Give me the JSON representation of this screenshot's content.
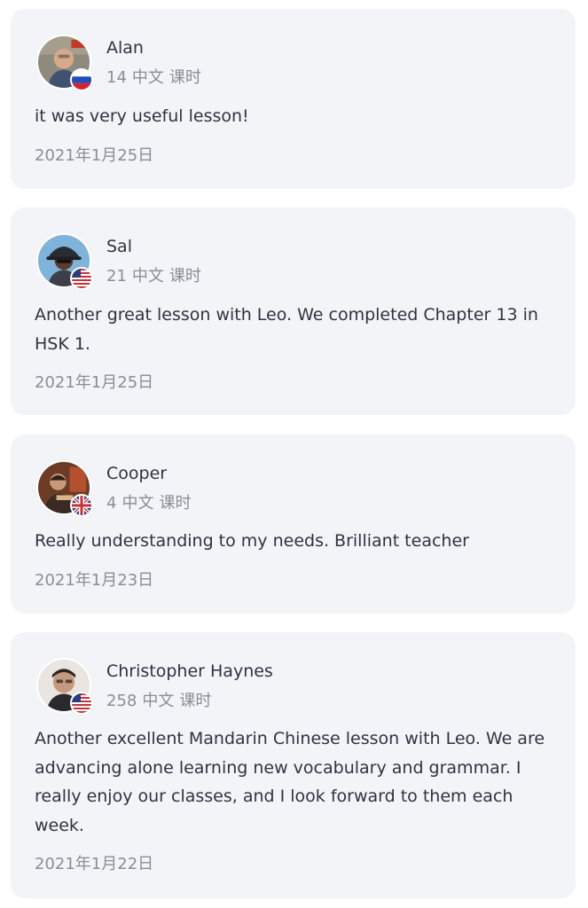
{
  "reviews": [
    {
      "name": "Alan",
      "lesson_count": "14",
      "language": "中文",
      "lessons_unit": "课时",
      "comment": "it was very useful lesson!",
      "date": "2021年1月25日",
      "flag": "russia-flag-icon"
    },
    {
      "name": "Sal",
      "lesson_count": "21",
      "language": "中文",
      "lessons_unit": "课时",
      "comment": "Another great lesson with Leo. We completed Chapter 13 in HSK 1.",
      "date": "2021年1月25日",
      "flag": "usa-flag-icon"
    },
    {
      "name": "Cooper",
      "lesson_count": "4",
      "language": "中文",
      "lessons_unit": "课时",
      "comment": "Really understanding to my needs. Brilliant teacher",
      "date": "2021年1月23日",
      "flag": "uk-flag-icon"
    },
    {
      "name": "Christopher Haynes",
      "lesson_count": "258",
      "language": "中文",
      "lessons_unit": "课时",
      "comment": "Another excellent Mandarin Chinese lesson with Leo. We are advancing alone learning new vocabulary and grammar. I really enjoy our classes, and I look forward to them each week.",
      "date": "2021年1月22日",
      "flag": "usa-flag-icon"
    }
  ]
}
